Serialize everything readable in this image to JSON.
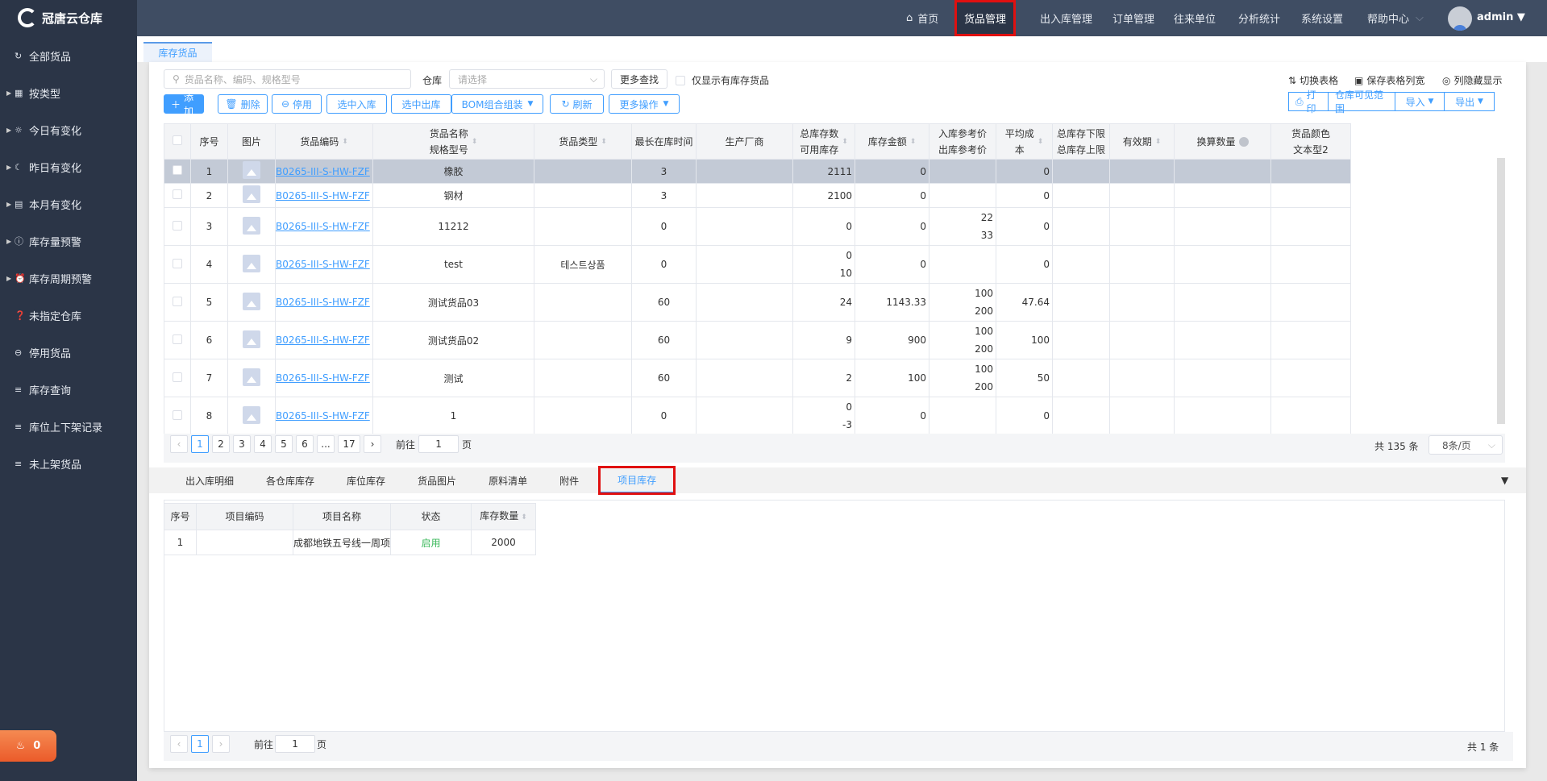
{
  "brand": "冠唐云仓库",
  "sidebar": {
    "items": [
      {
        "label": "全部货品",
        "icon": "refresh-icon",
        "arrow": false
      },
      {
        "label": "按类型",
        "icon": "grid-icon",
        "arrow": true
      },
      {
        "label": "今日有变化",
        "icon": "sunrise-icon",
        "arrow": true
      },
      {
        "label": "昨日有变化",
        "icon": "moon-icon",
        "arrow": true
      },
      {
        "label": "本月有变化",
        "icon": "calendar-icon",
        "arrow": true
      },
      {
        "label": "库存量预警",
        "icon": "warning-icon",
        "arrow": true
      },
      {
        "label": "库存周期预警",
        "icon": "alarm-icon",
        "arrow": true
      },
      {
        "label": "未指定仓库",
        "icon": "question-icon",
        "arrow": false
      },
      {
        "label": "停用货品",
        "icon": "minus-circle-icon",
        "arrow": false
      },
      {
        "label": "库存查询",
        "icon": "list-icon",
        "arrow": false
      },
      {
        "label": "库位上下架记录",
        "icon": "list-icon",
        "arrow": false
      },
      {
        "label": "未上架货品",
        "icon": "list-icon",
        "arrow": false
      }
    ],
    "alert_count": "0"
  },
  "topnav": {
    "items": [
      "首页",
      "货品管理",
      "出入库管理",
      "订单管理",
      "往来单位",
      "分析统计",
      "系统设置",
      "帮助中心"
    ],
    "active": "货品管理",
    "user": "admin"
  },
  "page_tab": "库存货品",
  "toolbar": {
    "search_placeholder": "货品名称、编码、规格型号",
    "warehouse_label": "仓库",
    "warehouse_placeholder": "请选择",
    "more_search": "更多查找",
    "only_stock": "仅显示有库存货品",
    "switch_table": "切换表格",
    "save_width": "保存表格列宽",
    "column_toggle": "列隐藏显示",
    "buttons": [
      "添加",
      "删除",
      "停用",
      "选中入库",
      "选中出库",
      "BOM组合组装",
      "刷新",
      "更多操作"
    ],
    "right_buttons": [
      "打印",
      "仓库可见范围",
      "导入",
      "导出"
    ]
  },
  "table": {
    "headers": [
      [
        "序号"
      ],
      [
        "图片"
      ],
      [
        "货品编码"
      ],
      [
        "货品名称",
        "规格型号"
      ],
      [
        "货品类型"
      ],
      [
        "最长在库时间"
      ],
      [
        "生产厂商"
      ],
      [
        "总库存数",
        "可用库存"
      ],
      [
        "库存金额"
      ],
      [
        "入库参考价",
        "出库参考价"
      ],
      [
        "平均成",
        "本"
      ],
      [
        "总库存下限",
        "总库存上限"
      ],
      [
        "有效期"
      ],
      [
        "换算数量"
      ],
      [
        "货品颜色",
        "文本型2"
      ]
    ],
    "rows": [
      {
        "no": "1",
        "code": "B0265-III-S-HW-FZF",
        "name": "橡胶",
        "type": "",
        "days": "3",
        "total": "2111",
        "avail": "",
        "amount": "0",
        "inprice": "",
        "outprice": "",
        "avg": "0"
      },
      {
        "no": "2",
        "code": "B0265-III-S-HW-FZF",
        "name": "钢材",
        "type": "",
        "days": "3",
        "total": "2100",
        "avail": "",
        "amount": "0",
        "inprice": "",
        "outprice": "",
        "avg": "0"
      },
      {
        "no": "3",
        "code": "B0265-III-S-HW-FZF",
        "name": "11212",
        "type": "",
        "days": "0",
        "total": "0",
        "avail": "",
        "amount": "0",
        "inprice": "22",
        "outprice": "33",
        "avg": "0"
      },
      {
        "no": "4",
        "code": "B0265-III-S-HW-FZF",
        "name": "test",
        "type": "테스트상품",
        "days": "0",
        "total": "0",
        "avail": "10",
        "amount": "0",
        "inprice": "",
        "outprice": "",
        "avg": "0"
      },
      {
        "no": "5",
        "code": "B0265-III-S-HW-FZF",
        "name": "测试货品03",
        "type": "",
        "days": "60",
        "total": "24",
        "avail": "",
        "amount": "1143.33",
        "inprice": "100",
        "outprice": "200",
        "avg": "47.64"
      },
      {
        "no": "6",
        "code": "B0265-III-S-HW-FZF",
        "name": "测试货品02",
        "type": "",
        "days": "60",
        "total": "9",
        "avail": "",
        "amount": "900",
        "inprice": "100",
        "outprice": "200",
        "avg": "100"
      },
      {
        "no": "7",
        "code": "B0265-III-S-HW-FZF",
        "name": "测试",
        "type": "",
        "days": "60",
        "total": "2",
        "avail": "",
        "amount": "100",
        "inprice": "100",
        "outprice": "200",
        "avg": "50"
      },
      {
        "no": "8",
        "code": "B0265-III-S-HW-FZF",
        "name": "1",
        "type": "",
        "days": "0",
        "total": "0",
        "avail": "-3",
        "amount": "0",
        "inprice": "",
        "outprice": "",
        "avg": "0"
      }
    ]
  },
  "pagination": {
    "pages": [
      "1",
      "2",
      "3",
      "4",
      "5",
      "6",
      "...",
      "17"
    ],
    "goto_label": "前往",
    "goto_value": "1",
    "page_unit": "页",
    "total": "共 135 条",
    "page_size": "8条/页"
  },
  "bottom_tabs": {
    "items": [
      "出入库明细",
      "各仓库库存",
      "库位库存",
      "货品图片",
      "原料清单",
      "附件",
      "项目库存"
    ],
    "active": "项目库存"
  },
  "project_table": {
    "headers": [
      "序号",
      "项目编码",
      "项目名称",
      "状态",
      "库存数量"
    ],
    "rows": [
      {
        "no": "1",
        "code": "",
        "name": "成都地铁五号线一周项",
        "status": "启用",
        "qty": "2000"
      }
    ]
  },
  "bottom_pagination": {
    "page": "1",
    "goto_label": "前往",
    "goto_value": "1",
    "page_unit": "页",
    "total": "共 1 条"
  },
  "colors": {
    "accent": "#409eff",
    "topbar": "#3f4d63",
    "sidebar": "#2b3547",
    "status_green": "#3cb95c"
  }
}
